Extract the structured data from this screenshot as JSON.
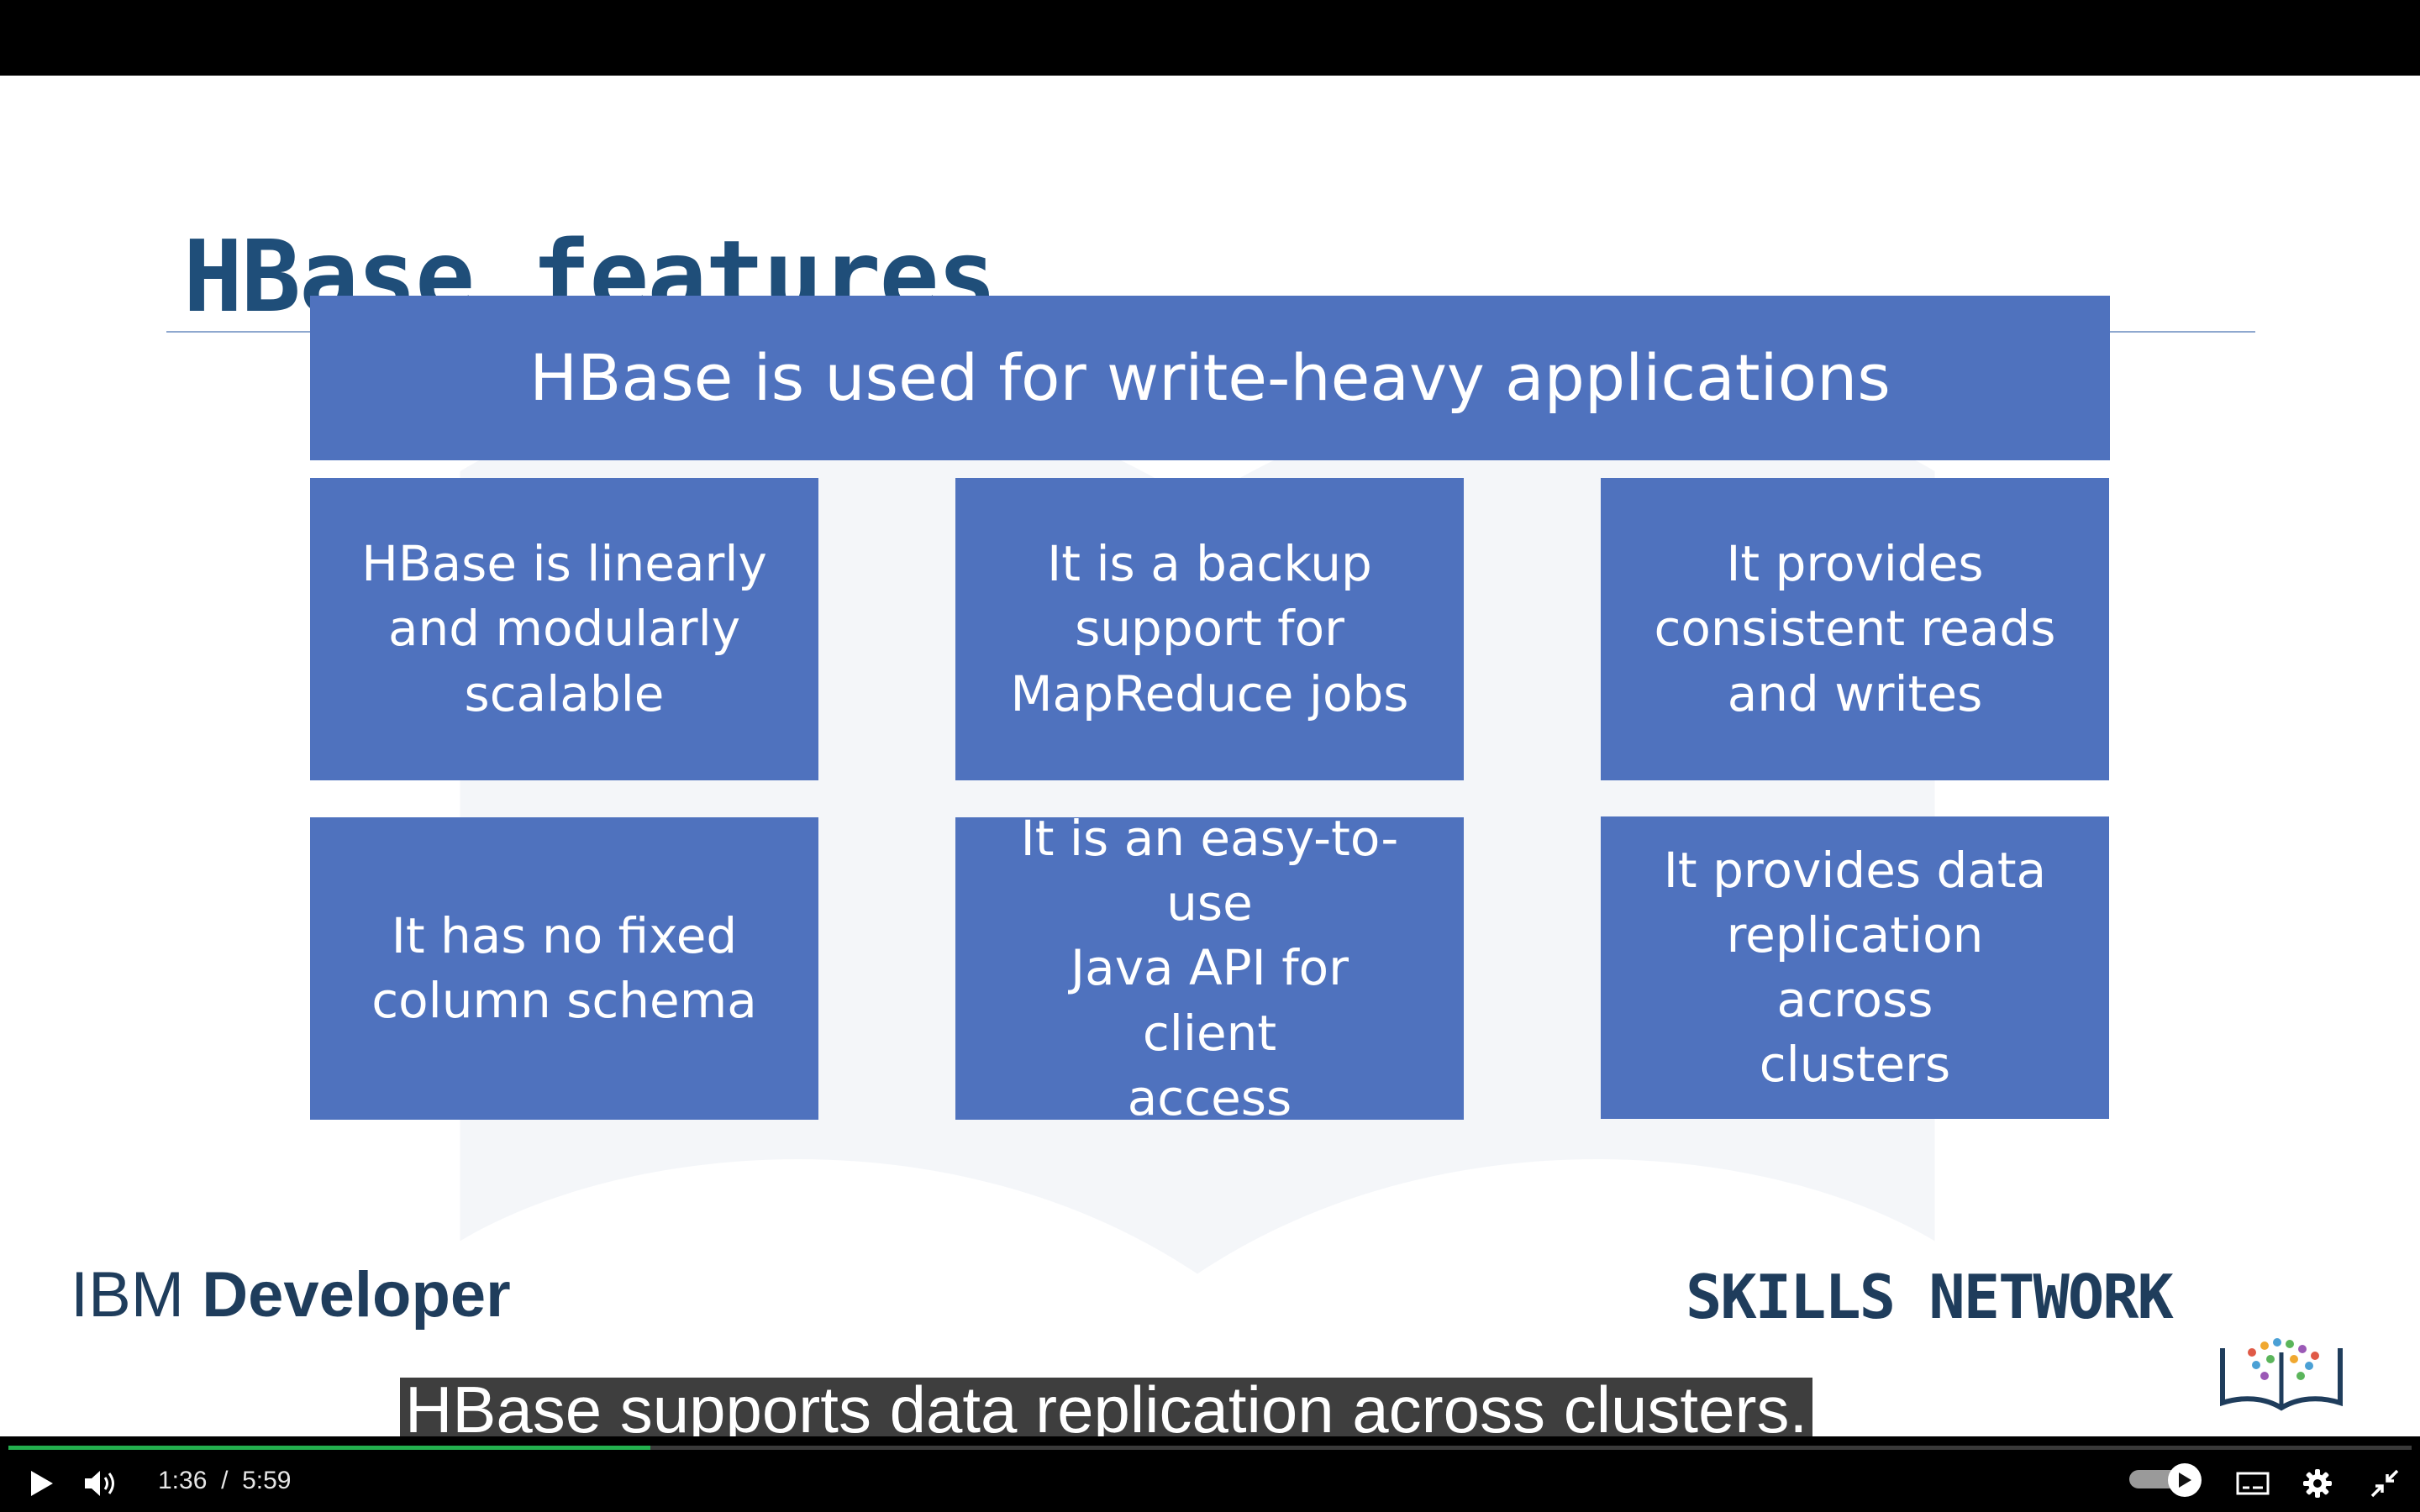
{
  "slide": {
    "title": "HBase features",
    "header_box": "HBase is used for write-heavy applications",
    "boxes": [
      {
        "line1": "HBase is linearly",
        "line2": "and modularly",
        "line3": "scalable"
      },
      {
        "line1": "It is a backup",
        "line2": "support for",
        "line3": "MapReduce jobs"
      },
      {
        "line1": "It provides",
        "line2": "consistent reads",
        "line3": "and writes"
      },
      {
        "line1": "It has no fixed",
        "line2": "column schema",
        "line3": ""
      },
      {
        "line1": "It is an easy-to-use",
        "line2": "Java API for client",
        "line3": "access"
      },
      {
        "line1": "It provides data",
        "line2": "replication across",
        "line3": "clusters"
      }
    ],
    "footer_left_regular": "IBM ",
    "footer_left_bold": "Developer",
    "footer_right": "SKILLS NETWORK"
  },
  "caption": "HBase supports data replication across clusters.",
  "player": {
    "current_time": "1:36",
    "separator": "/",
    "duration": "5:59",
    "progress_fraction": 0.267,
    "icons": [
      "play-icon",
      "volume-icon",
      "autoplay-toggle",
      "captions-icon",
      "settings-gear-icon",
      "exit-fullscreen-icon"
    ]
  },
  "colors": {
    "box_fill": "#4f72be",
    "title": "#1f4e79",
    "progress": "#23b04e"
  }
}
